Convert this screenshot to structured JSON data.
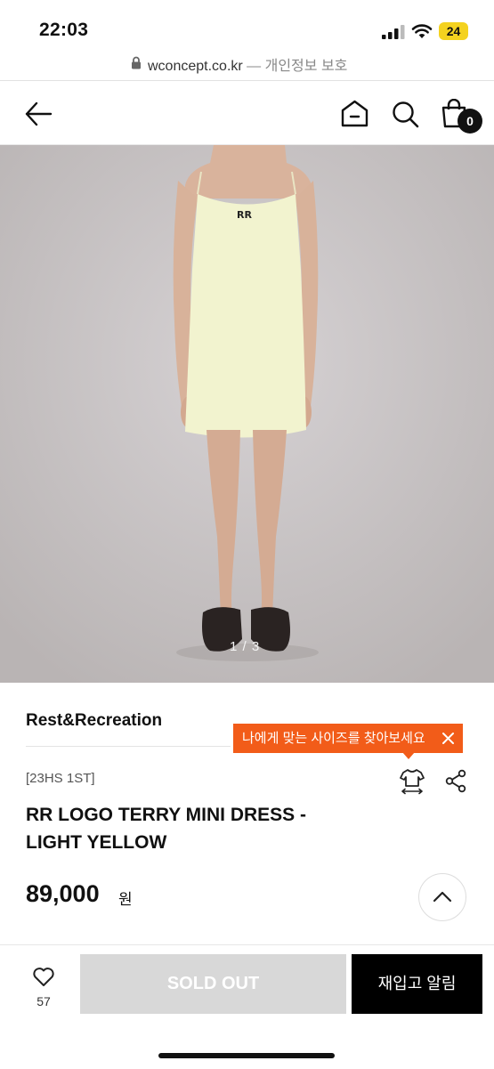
{
  "status_bar": {
    "time": "22:03",
    "battery": "24"
  },
  "browser": {
    "domain": "wconcept.co.kr",
    "suffix": "— 개인정보 보호"
  },
  "header": {
    "cart_count": "0",
    "icons": [
      "back-arrow-icon",
      "home-icon",
      "search-icon",
      "cart-icon"
    ]
  },
  "gallery": {
    "counter": "1 / 3"
  },
  "product": {
    "brand": "Rest&Recreation",
    "season": "[23HS 1ST]",
    "title_line1": "RR LOGO TERRY MINI DRESS -",
    "title_line2": "LIGHT YELLOW",
    "price": "89,000",
    "currency": "원"
  },
  "size_tooltip": {
    "text": "나에게 맞는 사이즈를 찾아보세요"
  },
  "bottom_bar": {
    "like_count": "57",
    "sold_out_label": "SOLD OUT",
    "restock_label": "재입고 알림"
  },
  "colors": {
    "accent_orange": "#f25c19",
    "sold_out_gray": "#d8d8d8",
    "black": "#000000"
  }
}
